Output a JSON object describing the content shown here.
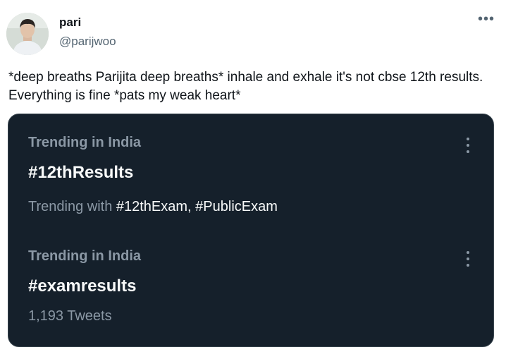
{
  "author": {
    "name": "pari",
    "handle": "@parijwoo"
  },
  "menu_icon": "more-horizontal-icon",
  "tweet_text": "*deep breaths Parijita deep breaths* inhale and exhale it's not cbse 12th results. Everything is fine *pats my weak heart*",
  "embedded_card": {
    "theme_background": "#15202b",
    "trends": [
      {
        "context": "Trending in India",
        "hashtag": "#12thResults",
        "subtitle_prefix": "Trending with ",
        "subtitle_tags": "#12thExam, #PublicExam"
      },
      {
        "context": "Trending in India",
        "hashtag": "#examresults",
        "subtitle": "1,193 Tweets"
      }
    ]
  }
}
